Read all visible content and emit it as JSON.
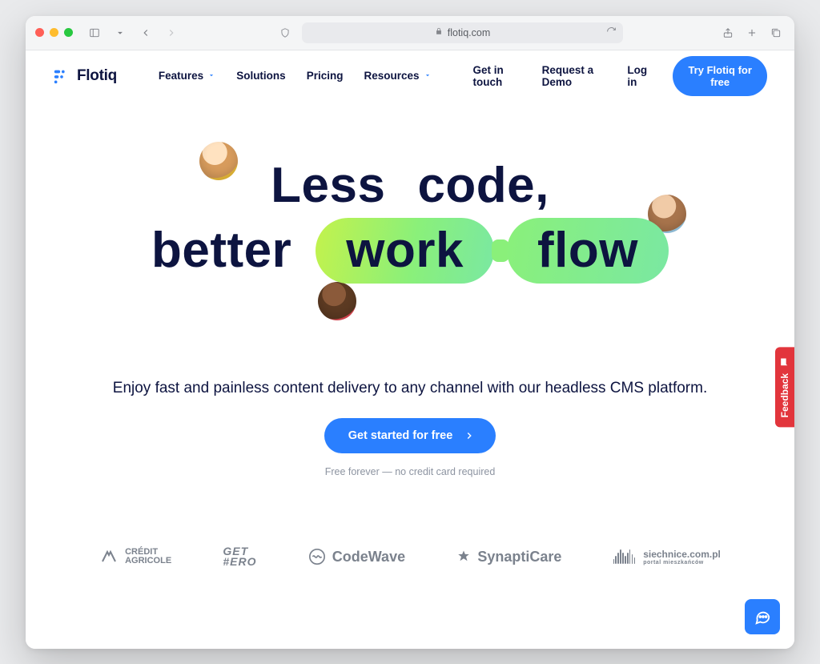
{
  "browser": {
    "url_display": "flotiq.com"
  },
  "nav": {
    "brand": "Flotiq",
    "items": [
      {
        "label": "Features",
        "dropdown": true
      },
      {
        "label": "Solutions",
        "dropdown": false
      },
      {
        "label": "Pricing",
        "dropdown": false
      },
      {
        "label": "Resources",
        "dropdown": true
      }
    ],
    "get_in_touch": "Get in touch",
    "request_demo": "Request a Demo",
    "log_in": "Log in",
    "try_free": "Try Flotiq for free"
  },
  "hero": {
    "line1_a": "Less",
    "line1_b": "code,",
    "line2_a": "better",
    "pill_a": "work",
    "pill_b": "flow",
    "subhead": "Enjoy fast and painless content delivery to any channel with our headless CMS platform.",
    "cta": "Get started for free",
    "fineprint": "Free forever — no credit card required"
  },
  "logos": {
    "credit_agricole_line1": "CRÉDIT",
    "credit_agricole_line2": "AGRICOLE",
    "gethero_line1": "GET",
    "gethero_line2": "#ERO",
    "codewave": "CodeWave",
    "synapticare": "SynaptiCare",
    "siechnice": "siechnice.com.pl",
    "siechnice_sub": "portal mieszkańców"
  },
  "widgets": {
    "feedback": "Feedback"
  }
}
